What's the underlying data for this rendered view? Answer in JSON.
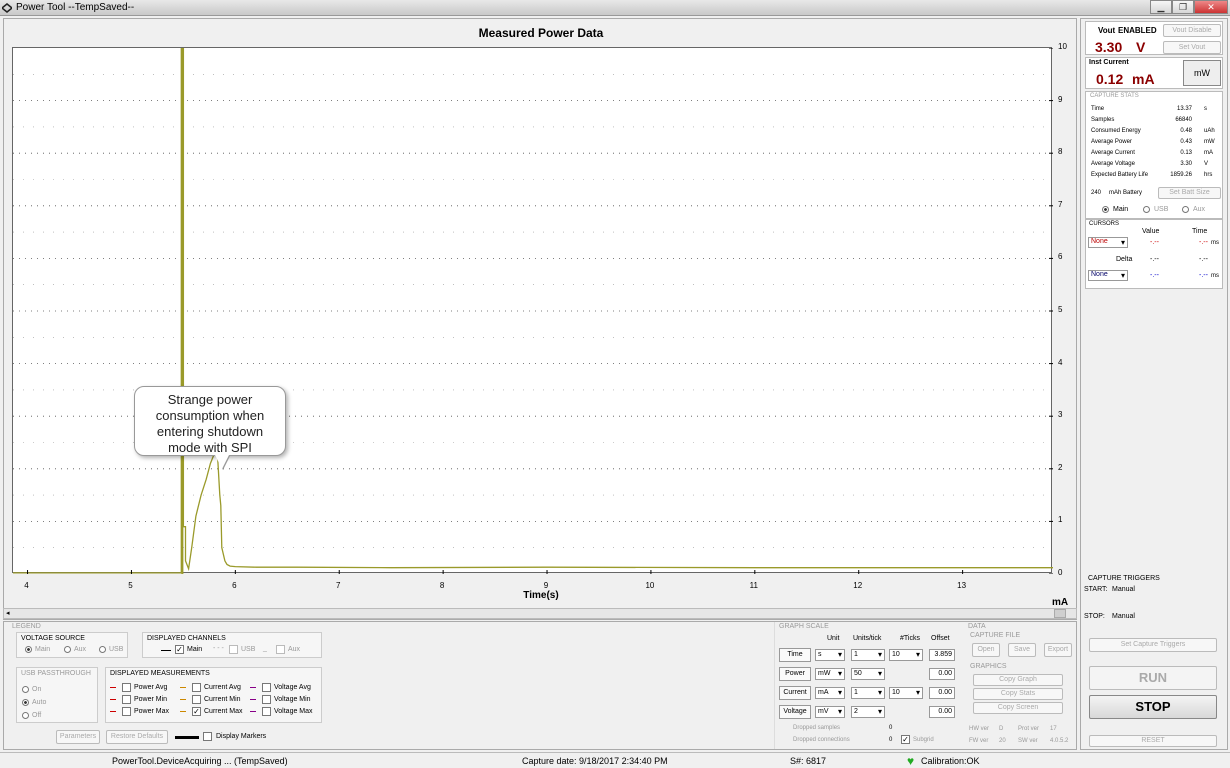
{
  "window": {
    "title": "Power Tool --TempSaved--",
    "minimize": "▁",
    "maximize": "❐",
    "close": "✕"
  },
  "chart_data": {
    "type": "line",
    "title": "Measured Power Data",
    "xlabel": "Time(s)",
    "ylabel": "mA",
    "xlim": [
      3.86,
      13.87
    ],
    "ylim": [
      0,
      10
    ],
    "x_ticks": [
      "4",
      "5",
      "6",
      "7",
      "8",
      "9",
      "10",
      "11",
      "12",
      "13"
    ],
    "y_ticks": [
      "0",
      "1",
      "2",
      "3",
      "4",
      "5",
      "6",
      "7",
      "8",
      "9",
      "10"
    ],
    "grid": true,
    "series": [
      {
        "color": "#9a9a2a",
        "x": [
          3.86,
          5.48,
          5.48,
          5.5,
          5.5,
          5.52,
          5.52,
          5.55,
          5.58,
          5.62,
          5.67,
          5.72,
          5.76,
          5.8,
          5.83,
          5.85,
          5.86,
          5.87,
          5.9,
          5.92,
          5.95,
          6.0,
          6.2,
          6.6,
          7.5,
          9,
          11,
          13,
          13.87
        ],
        "y": [
          0.02,
          0.02,
          10,
          10,
          0.9,
          0.9,
          0.25,
          0.1,
          0.5,
          1.1,
          1.5,
          1.8,
          2.1,
          2.3,
          2.2,
          1.5,
          1.3,
          0.5,
          0.25,
          0.18,
          0.15,
          0.14,
          0.13,
          0.13,
          0.12,
          0.13,
          0.12,
          0.12,
          0.12
        ]
      }
    ],
    "annotation": "Strange power consumption when entering shutdown mode with SPI"
  },
  "right": {
    "vout_label": "Vout",
    "vout_state": "ENABLED",
    "vout_disable": "Vout Disable",
    "vout_value": "3.30",
    "vout_unit": "V",
    "set_vout": "Set Vout",
    "inst_label": "Inst Current",
    "inst_value": "0.12",
    "inst_unit": "mA",
    "mw_button": "mW",
    "capture_stats_label": "CAPTURE STATS",
    "stats": [
      {
        "name": "Time",
        "value": "13.37",
        "unit": "s"
      },
      {
        "name": "Samples",
        "value": "66840",
        "unit": ""
      },
      {
        "name": "Consumed Energy",
        "value": "0.48",
        "unit": "uAh"
      },
      {
        "name": "Average Power",
        "value": "0.43",
        "unit": "mW"
      },
      {
        "name": "Average Current",
        "value": "0.13",
        "unit": "mA"
      },
      {
        "name": "Average Voltage",
        "value": "3.30",
        "unit": "V"
      },
      {
        "name": "Expected Battery Life",
        "value": "1859.26",
        "unit": "hrs"
      }
    ],
    "battery_value": "240",
    "battery_label": "mAh Battery",
    "set_batt": "Set Batt Size",
    "src_main": "Main",
    "src_usb": "USB",
    "src_aux": "Aux",
    "cursors_label": "CURSORS",
    "cursor_value_hdr": "Value",
    "cursor_time_hdr": "Time",
    "cursor1_sel": "None",
    "cursor1_value": "-.--",
    "cursor1_time": "-.--",
    "cursor_ms": "ms",
    "delta_label": "Delta",
    "delta_value": "-.--",
    "delta_time": "-.--",
    "cursor2_sel": "None",
    "cursor2_value": "-.--",
    "cursor2_time": "-.--",
    "capture_triggers_label": "CAPTURE TRIGGERS",
    "start_label": "START:",
    "start_value": "Manual",
    "stop_label": "STOP:",
    "stop_value": "Manual",
    "set_triggers": "Set Capture Triggers",
    "run": "RUN",
    "stop": "STOP",
    "reset": "RESET"
  },
  "bottom": {
    "legend_label": "LEGEND",
    "voltage_source_label": "VOLTAGE SOURCE",
    "vs_main": "Main",
    "vs_aux": "Aux",
    "vs_usb": "USB",
    "displayed_channels_label": "DISPLAYED CHANNELS",
    "ch_main": "Main",
    "ch_usb": "USB",
    "ch_aux": "Aux",
    "usb_passthrough_label": "USB PASSTHROUGH",
    "up_on": "On",
    "up_auto": "Auto",
    "up_off": "Off",
    "displayed_measurements_label": "DISPLAYED MEASUREMENTS",
    "m_power_avg": "Power Avg",
    "m_power_min": "Power Min",
    "m_power_max": "Power Max",
    "m_current_avg": "Current Avg",
    "m_current_min": "Current Min",
    "m_current_max": "Current Max",
    "m_voltage_avg": "Voltage Avg",
    "m_voltage_min": "Voltage Min",
    "m_voltage_max": "Voltage Max",
    "parameters": "Parameters",
    "restore": "Restore Defaults",
    "display_markers": "Display Markers",
    "graph_scale_label": "GRAPH SCALE",
    "hdr_unit": "Unit",
    "hdr_units_tick": "Units/tick",
    "hdr_ticks": "#Ticks",
    "hdr_offset": "Offset",
    "gs_time": "Time",
    "gs_time_unit": "s",
    "gs_time_upt": "1",
    "gs_time_ticks": "10",
    "gs_time_offset": "3.859",
    "gs_power": "Power",
    "gs_power_unit": "mW",
    "gs_power_upt": "50",
    "gs_power_offset": "0.00",
    "gs_current": "Current",
    "gs_current_unit": "mA",
    "gs_current_upt": "1",
    "gs_current_ticks": "10",
    "gs_current_offset": "0.00",
    "gs_voltage": "Voltage",
    "gs_voltage_unit": "mV",
    "gs_voltage_upt": "2",
    "gs_voltage_offset": "0.00",
    "dropped_samples": "Dropped samples",
    "dropped_samples_val": "0",
    "dropped_conn": "Dropped connections",
    "dropped_conn_val": "0",
    "subgrid": "Subgrid",
    "data_label": "DATA",
    "capture_file_label": "CAPTURE FILE",
    "open": "Open",
    "save": "Save",
    "export": "Export",
    "graphics_label": "GRAPHICS",
    "copy_graph": "Copy Graph",
    "copy_stats": "Copy Stats",
    "copy_screen": "Copy Screen",
    "hw_ver": "HW ver",
    "hw_ver_val": "D",
    "prot_ver": "Prot ver",
    "prot_ver_val": "17",
    "fw_ver": "FW ver",
    "fw_ver_val": "20",
    "sw_ver": "SW ver",
    "sw_ver_val": "4.0.5.2"
  },
  "status": {
    "state": "PowerTool.DeviceAcquiring ... (TempSaved)",
    "capture_date": "Capture date: 9/18/2017 2:34:40 PM",
    "serial": "S#: 6817",
    "calibration": "Calibration:OK"
  }
}
